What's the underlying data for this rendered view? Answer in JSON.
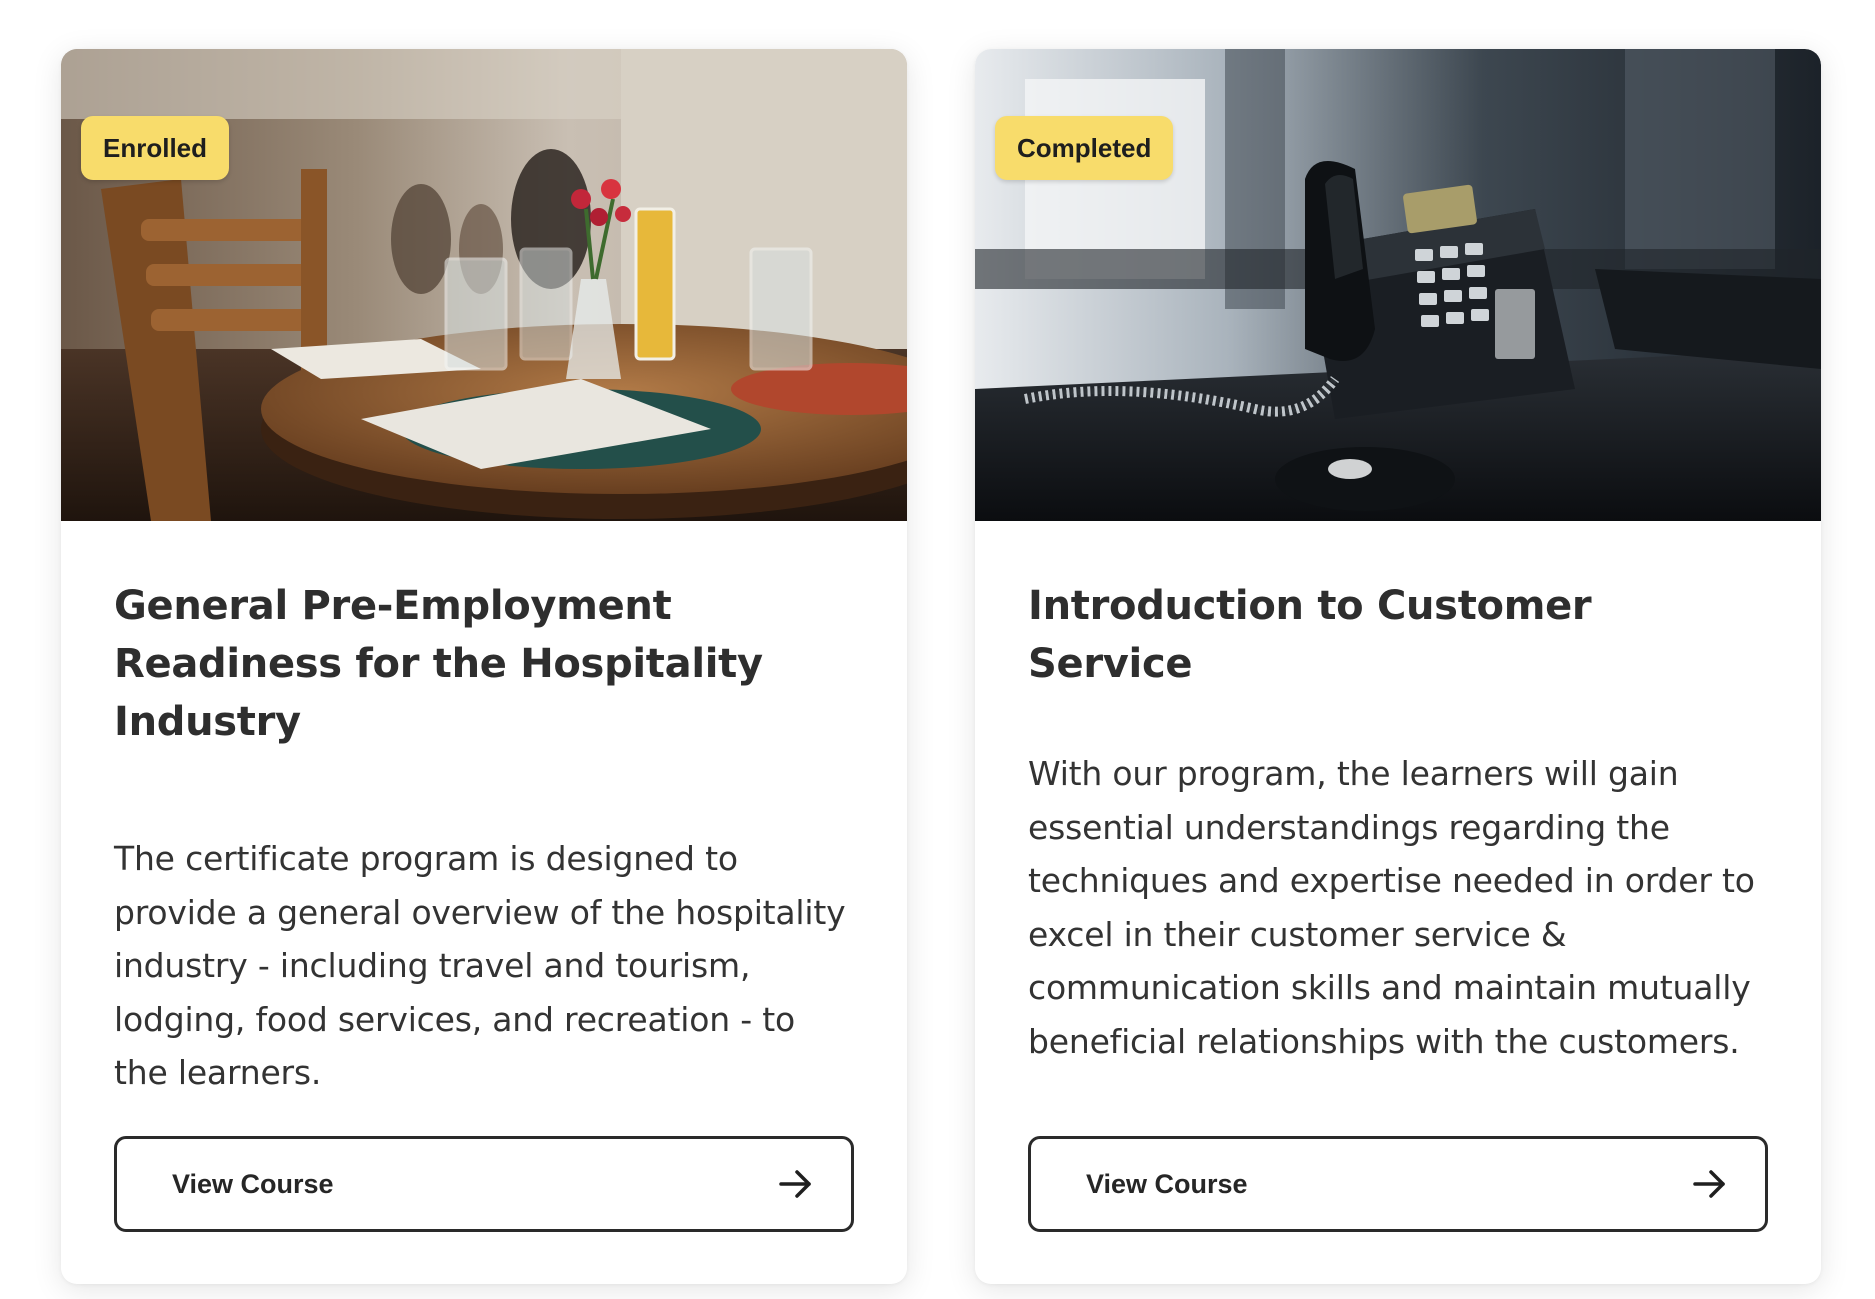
{
  "cards": [
    {
      "badge": "Enrolled",
      "image_icon": "restaurant-table-photo",
      "title": "General Pre-Employment Readiness for the Hospitality Industry",
      "description": "The certificate program is designed to provide a general overview of the hospitality industry - including travel and tourism, lodging, food services, and recreation - to the learners.",
      "button_label": "View Course",
      "button_icon": "arrow-right-icon"
    },
    {
      "badge": "Completed",
      "image_icon": "office-phone-photo",
      "title": "Introduction to Customer Service",
      "description": "With our program, the learners will gain essential understandings regarding the techniques and expertise needed in order to excel in their customer service & communication skills and maintain mutually beneficial relationships with the customers.",
      "button_label": "View Course",
      "button_icon": "arrow-right-icon"
    }
  ],
  "colors": {
    "badge": "#f8dc6b",
    "text": "#2e2e2e",
    "button_border": "#2a2a2a"
  }
}
